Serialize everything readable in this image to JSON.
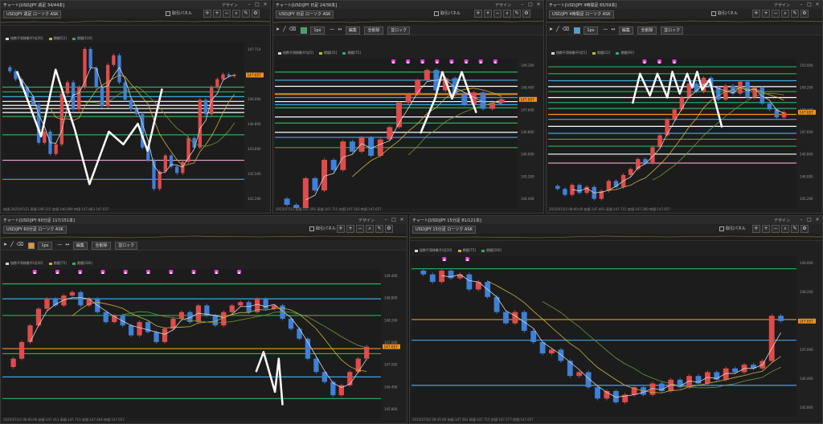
{
  "colors": {
    "up": "#e04b4b",
    "down": "#3f80d8",
    "bg": "#1c1c1c",
    "green": "#2fae5a",
    "orange": "#f0941f",
    "blue": "#3fa6e0",
    "pink": "#f2a3cf",
    "white": "#ffffff",
    "magenta": "#e23fd6",
    "ma1": "#d8d8d8",
    "ma2": "#c8b43a",
    "ma3": "#6a9a3a"
  },
  "panels": [
    {
      "id": "p1",
      "title": "チャート[USD/JPY 週足 34/44本]",
      "symbol": "USD/JPY 週足 ローソク ASK",
      "design": "デザイン",
      "panel_toggle": "取引パネル",
      "legend": [
        {
          "label": "指数平滑移動平均[20]",
          "color": "#d8d8d8"
        },
        {
          "label": "期間[52]",
          "color": "#c8b43a"
        },
        {
          "label": "期間[104]",
          "color": "#2fae5a"
        }
      ],
      "status": "始値:2025/07/21 高値:149.115 安値:146.699 終値:147.883 147.657",
      "price_tag": "147.657",
      "has_toolbar2": false
    },
    {
      "id": "p2",
      "title": "チャート[USD/JPY 日足 24/36本]",
      "symbol": "USD/JPY 日足 ローソク ASK",
      "design": "デザイン",
      "panel_toggle": "取引パネル",
      "legend": [
        {
          "label": "指数平滑移動平均[5]",
          "color": "#d8d8d8"
        },
        {
          "label": "期間[25]",
          "color": "#c8b43a"
        },
        {
          "label": "期間[75]",
          "color": "#2fae5a"
        }
      ],
      "status": "2025/07/22 始値:147.291 高値:147.715 安値:147.163 終値:147.657",
      "price_tag": "147.657",
      "has_toolbar2": true,
      "tb2_buttons": [
        "編集",
        "全削除",
        "並ロック"
      ],
      "tb2_lot": "1px"
    },
    {
      "id": "p3",
      "title": "チャート[USD/JPY 4時間足 65/59本]",
      "symbol": "USD/JPY 4時間足 ローソク ASK",
      "design": "デザイン",
      "panel_toggle": "取引パネル",
      "legend": [
        {
          "label": "指数平滑移動平均[5]",
          "color": "#d8d8d8"
        },
        {
          "label": "期間[21]",
          "color": "#c8b43a"
        },
        {
          "label": "期間[90]",
          "color": "#2fae5a"
        }
      ],
      "status": "2025/07/22 08:00:00 始値:147.401 高値:147.715 安値:147.280 終値:147.657",
      "price_tag": "147.657",
      "has_toolbar2": true,
      "tb2_buttons": [
        "編集",
        "全削除",
        "並ロック"
      ],
      "tb2_lot": "1px"
    },
    {
      "id": "p4",
      "title": "チャート[USD/JPY 60分足 117/151本]",
      "symbol": "USD/JPY 60分足 ローソク ASK",
      "design": "デザイン",
      "panel_toggle": "取引パネル",
      "legend": [
        {
          "label": "指数平滑移動平均[20]",
          "color": "#d8d8d8"
        },
        {
          "label": "期間[75]",
          "color": "#c8b43a"
        },
        {
          "label": "期間[200]",
          "color": "#2fae5a"
        }
      ],
      "status": "2025/07/22 09:00:00 始値:147.411 高値:147.715 安値:147.404 終値:147.657",
      "price_tag": "147.657",
      "has_toolbar2": true,
      "tb2_buttons": [
        "編集",
        "全削除",
        "並ロック"
      ],
      "tb2_lot": "1px"
    },
    {
      "id": "p5",
      "title": "チャート[USD/JPY 15分足 81/121本]",
      "symbol": "USD/JPY 15分足 ローソク ASK",
      "design": "デザイン",
      "panel_toggle": "取引パネル",
      "legend": [
        {
          "label": "指数平滑移動平均[20]",
          "color": "#d8d8d8"
        },
        {
          "label": "期間[75]",
          "color": "#c8b43a"
        },
        {
          "label": "期間[200]",
          "color": "#2fae5a"
        }
      ],
      "status": "2025/07/22 09:45:00 始値:147.581 高値:147.715 安値:147.577 終値:147.657",
      "price_tag": "147.657",
      "has_toolbar2": false
    }
  ],
  "chart_data": [
    {
      "panel": "p1",
      "type": "candlestick",
      "timeframe": "週足",
      "close": [
        147.9,
        147.4,
        146.9,
        146.3,
        145.8,
        143.4,
        144.1,
        142.7,
        143.3,
        146.5,
        147.2,
        145.5,
        146.9,
        149.3,
        148.1,
        146.9,
        145.7,
        148.3,
        148.9,
        147.2,
        146.1,
        145.5,
        145.2,
        143.1,
        142.3,
        140.5,
        141.6,
        142.6,
        141.9,
        141.5,
        142.2,
        143.7,
        143.1,
        146.1,
        145.2,
        146.9,
        147.4,
        147.7,
        147.6,
        147.66
      ],
      "ylim": [
        139.5,
        149.5
      ],
      "hlines": [
        {
          "y": 146.9,
          "c": "green"
        },
        {
          "y": 146.6,
          "c": "green"
        },
        {
          "y": 146.3,
          "c": "blue"
        },
        {
          "y": 146.0,
          "c": "white"
        },
        {
          "y": 145.75,
          "c": "white"
        },
        {
          "y": 145.55,
          "c": "white"
        },
        {
          "y": 145.3,
          "c": "white"
        },
        {
          "y": 145.05,
          "c": "green"
        },
        {
          "y": 143.9,
          "c": "green"
        },
        {
          "y": 142.3,
          "c": "pink"
        },
        {
          "y": 141.1,
          "c": "blue"
        }
      ],
      "zigzag": [
        [
          0.06,
          147.9
        ],
        [
          0.16,
          143.8
        ],
        [
          0.22,
          148.0
        ],
        [
          0.3,
          144.2
        ],
        [
          0.36,
          140.8
        ],
        [
          0.44,
          144.1
        ],
        [
          0.5,
          143.3
        ],
        [
          0.56,
          144.6
        ],
        [
          0.6,
          142.9
        ],
        [
          0.66,
          146.8
        ]
      ],
      "ticks": [
        "147.714",
        "146.900",
        "146.000",
        "144.800",
        "143.600",
        "142.500",
        "141.200"
      ],
      "markers": []
    },
    {
      "panel": "p2",
      "type": "candlestick",
      "timeframe": "日足",
      "close": [
        142.5,
        141.9,
        143.8,
        143.2,
        144.7,
        144.2,
        145.6,
        145.1,
        145.8,
        144.9,
        145.7,
        146.3,
        147.5,
        147.9,
        148.6,
        149.1,
        148.1,
        148.7,
        147.9,
        147.4,
        148.0,
        147.2,
        147.5,
        147.66
      ],
      "ylim": [
        142.5,
        149.5
      ],
      "hlines": [
        {
          "y": 149.0,
          "c": "green"
        },
        {
          "y": 148.6,
          "c": "blue"
        },
        {
          "y": 148.3,
          "c": "white"
        },
        {
          "y": 147.95,
          "c": "green"
        },
        {
          "y": 147.75,
          "c": "blue"
        },
        {
          "y": 147.9,
          "c": "orange"
        },
        {
          "y": 147.55,
          "c": "white"
        },
        {
          "y": 147.4,
          "c": "blue"
        },
        {
          "y": 147.25,
          "c": "green"
        },
        {
          "y": 146.8,
          "c": "white"
        },
        {
          "y": 146.5,
          "c": "green"
        },
        {
          "y": 146.05,
          "c": "white"
        },
        {
          "y": 145.8,
          "c": "blue"
        },
        {
          "y": 145.3,
          "c": "green"
        }
      ],
      "zigzag": [
        [
          0.6,
          146.0
        ],
        [
          0.66,
          147.7
        ],
        [
          0.69,
          149.0
        ],
        [
          0.73,
          147.7
        ],
        [
          0.77,
          149.0
        ],
        [
          0.83,
          147.0
        ]
      ],
      "ticks": [
        "149.300",
        "148.400",
        "147.600",
        "146.800",
        "146.000",
        "145.200",
        "144.400"
      ],
      "markers": [
        "▲",
        "▲",
        "▲",
        "▲",
        "▲",
        "▲",
        "▲",
        "▲"
      ]
    },
    {
      "panel": "p3",
      "type": "candlestick",
      "timeframe": "4時間足",
      "close": [
        143.8,
        143.5,
        144.0,
        143.6,
        143.9,
        143.3,
        143.7,
        144.2,
        143.9,
        144.5,
        144.8,
        145.3,
        145.1,
        145.9,
        146.5,
        147.3,
        147.8,
        148.4,
        149.1,
        148.7,
        149.4,
        148.9,
        148.3,
        149.0,
        148.6,
        149.2,
        148.4,
        148.9,
        148.1,
        147.8,
        147.4,
        147.66
      ],
      "ylim": [
        143.0,
        150.2
      ],
      "hlines": [
        {
          "y": 149.95,
          "c": "green"
        },
        {
          "y": 149.6,
          "c": "green"
        },
        {
          "y": 149.25,
          "c": "blue"
        },
        {
          "y": 148.95,
          "c": "white"
        },
        {
          "y": 148.7,
          "c": "green"
        },
        {
          "y": 148.4,
          "c": "white"
        },
        {
          "y": 148.15,
          "c": "green"
        },
        {
          "y": 147.85,
          "c": "green"
        },
        {
          "y": 147.55,
          "c": "orange"
        },
        {
          "y": 147.3,
          "c": "blue"
        },
        {
          "y": 146.95,
          "c": "white"
        },
        {
          "y": 146.6,
          "c": "blue"
        },
        {
          "y": 146.3,
          "c": "green"
        },
        {
          "y": 145.95,
          "c": "green"
        },
        {
          "y": 145.55,
          "c": "white"
        },
        {
          "y": 145.1,
          "c": "pink"
        }
      ],
      "zigzag": [
        [
          0.34,
          148.1
        ],
        [
          0.37,
          149.6
        ],
        [
          0.41,
          148.5
        ],
        [
          0.44,
          149.6
        ],
        [
          0.48,
          148.4
        ],
        [
          0.5,
          149.7
        ],
        [
          0.53,
          148.6
        ],
        [
          0.56,
          149.6
        ],
        [
          0.58,
          148.9
        ],
        [
          0.6,
          149.7
        ],
        [
          0.62,
          148.8
        ],
        [
          0.65,
          149.3
        ],
        [
          0.7,
          146.9
        ]
      ],
      "ticks": [
        "150.000",
        "149.200",
        "148.400",
        "147.600",
        "146.800",
        "146.000",
        "145.200"
      ],
      "markers": [
        "▲",
        "▲",
        "▲"
      ]
    },
    {
      "panel": "p4",
      "type": "candlestick",
      "timeframe": "60分足",
      "close": [
        147.3,
        147.8,
        148.3,
        148.8,
        149.1,
        148.9,
        149.2,
        149.3,
        148.9,
        149.1,
        148.7,
        148.4,
        148.6,
        148.3,
        148.0,
        148.4,
        148.1,
        147.8,
        148.2,
        148.5,
        148.7,
        148.4,
        148.9,
        148.6,
        148.3,
        148.7,
        148.9,
        149.0,
        148.7,
        149.1,
        148.8,
        148.9,
        148.5,
        148.2,
        147.9,
        147.3,
        146.9,
        146.6,
        146.2,
        146.5,
        146.9,
        147.3,
        147.66
      ],
      "ylim": [
        145.6,
        149.9
      ],
      "hlines": [
        {
          "y": 149.55,
          "c": "green"
        },
        {
          "y": 149.1,
          "c": "blue"
        },
        {
          "y": 148.6,
          "c": "green"
        },
        {
          "y": 147.6,
          "c": "orange"
        },
        {
          "y": 147.45,
          "c": "green"
        },
        {
          "y": 146.75,
          "c": "blue"
        },
        {
          "y": 146.1,
          "c": "green"
        }
      ],
      "zigzag": [
        [
          0.67,
          146.9
        ],
        [
          0.69,
          147.5
        ],
        [
          0.72,
          146.3
        ],
        [
          0.73,
          147.3
        ],
        [
          0.74,
          145.9
        ]
      ],
      "ticks": [
        "149.400",
        "148.800",
        "148.200",
        "147.600",
        "147.000",
        "146.400",
        "145.800"
      ],
      "markers": [
        "▲",
        "▲",
        "▲",
        "▲",
        "▲",
        "▲",
        "▲",
        "▲",
        "▲",
        "▲"
      ]
    },
    {
      "panel": "p5",
      "type": "candlestick",
      "timeframe": "15分足",
      "close": [
        148.9,
        148.7,
        149.0,
        148.8,
        148.9,
        148.5,
        148.7,
        148.3,
        147.9,
        147.6,
        147.9,
        147.4,
        147.1,
        146.8,
        146.9,
        146.6,
        146.2,
        146.3,
        145.9,
        145.6,
        145.8,
        145.5,
        145.7,
        145.9,
        145.7,
        146.0,
        145.8,
        146.1,
        145.9,
        146.2,
        146.0,
        146.3,
        146.1,
        146.4,
        146.3,
        146.5,
        146.4,
        146.6,
        147.8,
        147.66
      ],
      "ylim": [
        145.2,
        149.3
      ],
      "hlines": [
        {
          "y": 149.05,
          "c": "green"
        },
        {
          "y": 147.7,
          "c": "orange"
        },
        {
          "y": 147.15,
          "c": "blue"
        },
        {
          "y": 145.95,
          "c": "blue"
        }
      ],
      "zigzag": [],
      "ticks": [
        "149.000",
        "148.200",
        "147.600",
        "147.000",
        "146.400",
        "145.800"
      ],
      "markers": [
        "▲",
        "▲"
      ]
    }
  ]
}
